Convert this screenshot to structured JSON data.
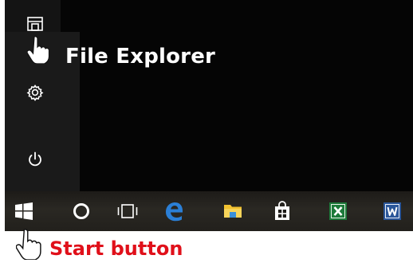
{
  "annotations": {
    "file_explorer_label": "File Explorer",
    "start_button_label": "Start button"
  },
  "start_menu": {
    "rail_items": [
      {
        "icon": "file-explorer-icon"
      },
      {
        "icon": "settings-icon"
      },
      {
        "icon": "power-icon"
      }
    ]
  },
  "taskbar": {
    "items": [
      {
        "icon": "windows-start-icon"
      },
      {
        "icon": "cortana-search-icon"
      },
      {
        "icon": "task-view-icon"
      },
      {
        "icon": "edge-icon"
      },
      {
        "icon": "file-explorer-icon"
      },
      {
        "icon": "store-icon"
      },
      {
        "icon": "excel-icon"
      },
      {
        "icon": "word-icon"
      }
    ]
  },
  "colors": {
    "annotation_red": "#e0101a",
    "edge_blue": "#2b7fd6",
    "folder_yellow": "#f2c230",
    "excel_green": "#1d7a3a",
    "word_blue": "#2a5699"
  }
}
